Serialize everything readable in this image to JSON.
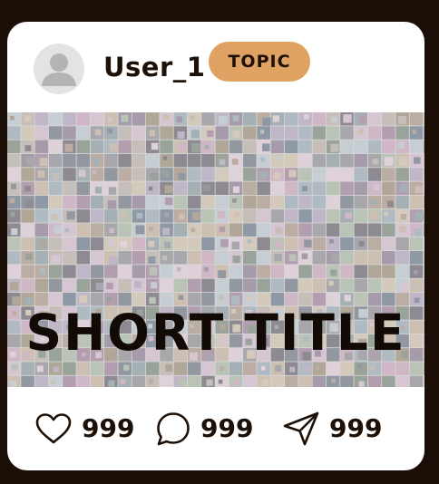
{
  "post": {
    "username": "User_1",
    "topic": "TOPIC",
    "media_title": "SHORT TITLE",
    "icons": {
      "avatar": "default-user-avatar",
      "like": "heart-outline-icon",
      "comment": "speech-bubble-icon",
      "share": "paper-plane-icon"
    }
  },
  "actions": {
    "likes": "999",
    "comments": "999",
    "shares": "999"
  },
  "colors": {
    "background": "#1a0e06",
    "card": "#ffffff",
    "topic_badge": "#dfa262",
    "text": "#1c1007"
  }
}
